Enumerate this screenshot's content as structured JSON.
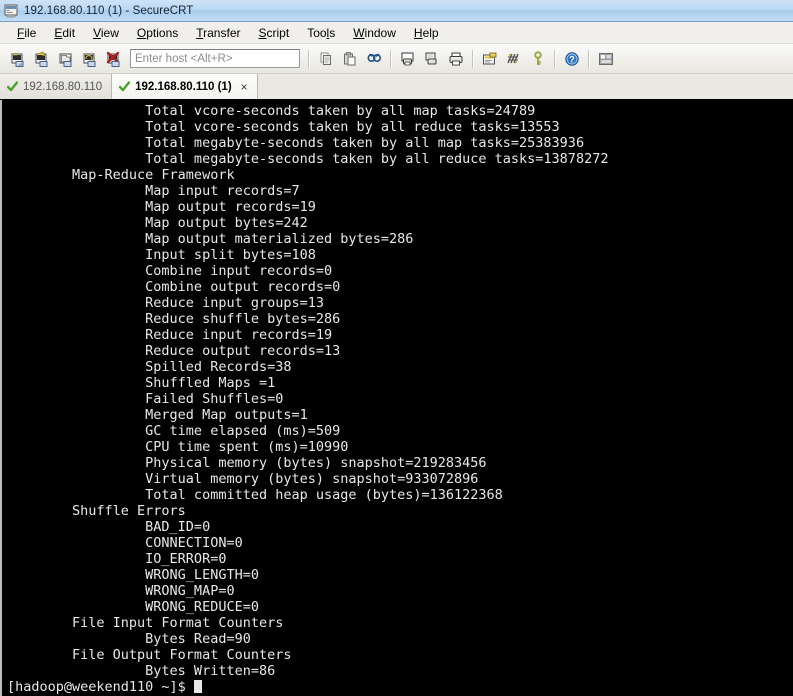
{
  "window": {
    "title": "192.168.80.110 (1) - SecureCRT",
    "icon": "securecrt-app-icon"
  },
  "menubar": {
    "items": [
      {
        "label": "File",
        "mnemonic": "F"
      },
      {
        "label": "Edit",
        "mnemonic": "E"
      },
      {
        "label": "View",
        "mnemonic": "V"
      },
      {
        "label": "Options",
        "mnemonic": "O"
      },
      {
        "label": "Transfer",
        "mnemonic": "T"
      },
      {
        "label": "Script",
        "mnemonic": "S"
      },
      {
        "label": "Tools",
        "mnemonic": "l"
      },
      {
        "label": "Window",
        "mnemonic": "W"
      },
      {
        "label": "Help",
        "mnemonic": "H"
      }
    ]
  },
  "toolbar": {
    "host_placeholder": "Enter host <Alt+R>",
    "host_value": "",
    "buttons": [
      {
        "name": "new-session-icon"
      },
      {
        "name": "connect-session-icon"
      },
      {
        "name": "open-folder-icon"
      },
      {
        "name": "reconnect-icon"
      },
      {
        "name": "disconnect-icon"
      },
      {
        "name": "copy-icon"
      },
      {
        "name": "paste-icon"
      },
      {
        "name": "find-icon"
      },
      {
        "name": "print-screen-icon"
      },
      {
        "name": "log-session-icon"
      },
      {
        "name": "print-icon"
      },
      {
        "name": "session-options-icon"
      },
      {
        "name": "global-options-icon"
      },
      {
        "name": "key-icon"
      },
      {
        "name": "help-icon"
      },
      {
        "name": "arrange-icon"
      }
    ]
  },
  "tabs": [
    {
      "label": "192.168.80.110",
      "active": false,
      "status": "connected"
    },
    {
      "label": "192.168.80.110 (1)",
      "active": true,
      "status": "connected",
      "close": "×"
    }
  ],
  "terminal": {
    "prompt": "[hadoop@weekend110 ~]$ ",
    "lines": [
      "                 Total vcore-seconds taken by all map tasks=24789",
      "                 Total vcore-seconds taken by all reduce tasks=13553",
      "                 Total megabyte-seconds taken by all map tasks=25383936",
      "                 Total megabyte-seconds taken by all reduce tasks=13878272",
      "        Map-Reduce Framework",
      "                 Map input records=7",
      "                 Map output records=19",
      "                 Map output bytes=242",
      "                 Map output materialized bytes=286",
      "                 Input split bytes=108",
      "                 Combine input records=0",
      "                 Combine output records=0",
      "                 Reduce input groups=13",
      "                 Reduce shuffle bytes=286",
      "                 Reduce input records=19",
      "                 Reduce output records=13",
      "                 Spilled Records=38",
      "                 Shuffled Maps =1",
      "                 Failed Shuffles=0",
      "                 Merged Map outputs=1",
      "                 GC time elapsed (ms)=509",
      "                 CPU time spent (ms)=10990",
      "                 Physical memory (bytes) snapshot=219283456",
      "                 Virtual memory (bytes) snapshot=933072896",
      "                 Total committed heap usage (bytes)=136122368",
      "        Shuffle Errors",
      "                 BAD_ID=0",
      "                 CONNECTION=0",
      "                 IO_ERROR=0",
      "                 WRONG_LENGTH=0",
      "                 WRONG_MAP=0",
      "                 WRONG_REDUCE=0",
      "        File Input Format Counters",
      "                 Bytes Read=90",
      "        File Output Format Counters",
      "                 Bytes Written=86"
    ]
  },
  "colors": {
    "terminal_bg": "#000000",
    "terminal_fg": "#e8e8e8",
    "titlebar": "#bcd8f2",
    "chrome": "#f0efeb",
    "tab_check": "#4ca32c"
  }
}
